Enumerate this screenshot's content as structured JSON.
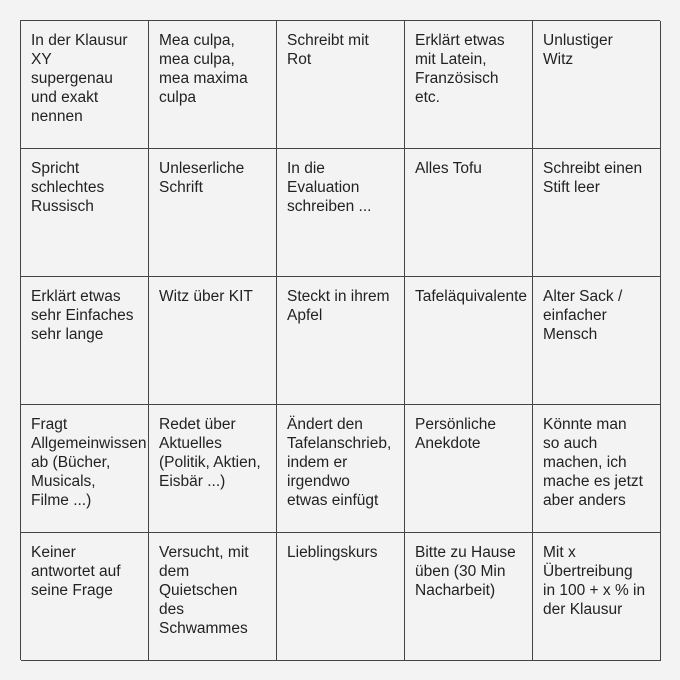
{
  "bingo": {
    "cells": [
      "In der Klausur\nXY\nsupergenau\nund exakt\nnennen",
      "Mea culpa,\nmea culpa,\nmea maxima\nculpa",
      "Schreibt mit\nRot",
      "Erklärt etwas\nmit Latein,\nFranzösisch\netc.",
      "Unlustiger\nWitz",
      "Spricht\nschlechtes\nRussisch",
      "Unleserliche\nSchrift",
      "In die\nEvaluation\nschreiben ...",
      "Alles Tofu",
      "Schreibt einen\nStift leer",
      "Erklärt etwas\nsehr Einfaches\nsehr lange",
      "Witz über KIT",
      "Steckt in ihrem\nApfel",
      "Tafeläquivalente",
      "Alter Sack /\neinfacher\nMensch",
      "Fragt\nAllgemeinwissen\nab (Bücher,\nMusicals,\nFilme ...)",
      "Redet über\nAktuelles\n(Politik, Aktien,\nEisbär ...)",
      "Ändert den\nTafelanschrieb,\nindem er\nirgendwo\netwas einfügt",
      "Persönliche\nAnekdote",
      "Könnte man\nso auch\nmachen, ich\nmache es jetzt\naber anders",
      "Keiner\nantwortet auf\nseine Frage",
      "Versucht, mit\ndem\nQuietschen\ndes\nSchwammes",
      "Lieblingskurs",
      "Bitte zu Hause\nüben (30 Min\nNacharbeit)",
      "Mit x\nÜbertreibung\nin 100 + x % in\nder Klausur"
    ]
  }
}
